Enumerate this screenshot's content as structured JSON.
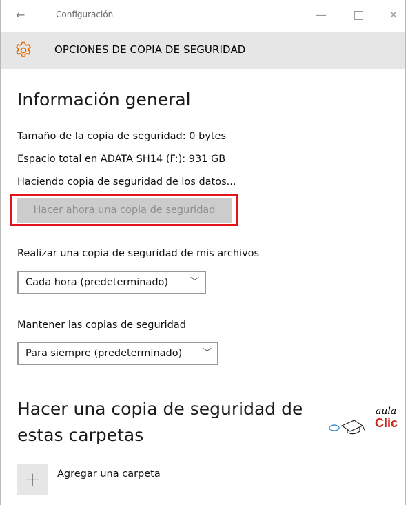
{
  "titlebar": {
    "back_glyph": "←",
    "title": "Configuración",
    "minimize_glyph": "—",
    "close_glyph": "✕"
  },
  "header": {
    "icon": "gear-icon",
    "title": "OPCIONES DE COPIA DE SEGURIDAD",
    "background": "#e6e6e6",
    "accent": "#e36c0a"
  },
  "overview": {
    "heading": "Información general",
    "backup_size": "Tamaño de la copia de seguridad: 0 bytes",
    "total_space": "Espacio total en ADATA SH14 (F:): 931 GB",
    "status": "Haciendo copia de seguridad de los datos...",
    "backup_now_button": "Hacer ahora una copia de seguridad",
    "highlight_color": "#e3151b"
  },
  "frequency": {
    "label": "Realizar una copia de seguridad de mis archivos",
    "selected": "Cada hora (predeterminado)"
  },
  "retention": {
    "label": "Mantener las copias de seguridad",
    "selected": "Para siempre (predeterminado)"
  },
  "folders": {
    "heading": "Hacer una copia de seguridad de estas carpetas",
    "add_glyph": "+",
    "add_label": "Agregar una carpeta"
  },
  "watermark": {
    "line1": "aula",
    "line2": "Clic"
  }
}
